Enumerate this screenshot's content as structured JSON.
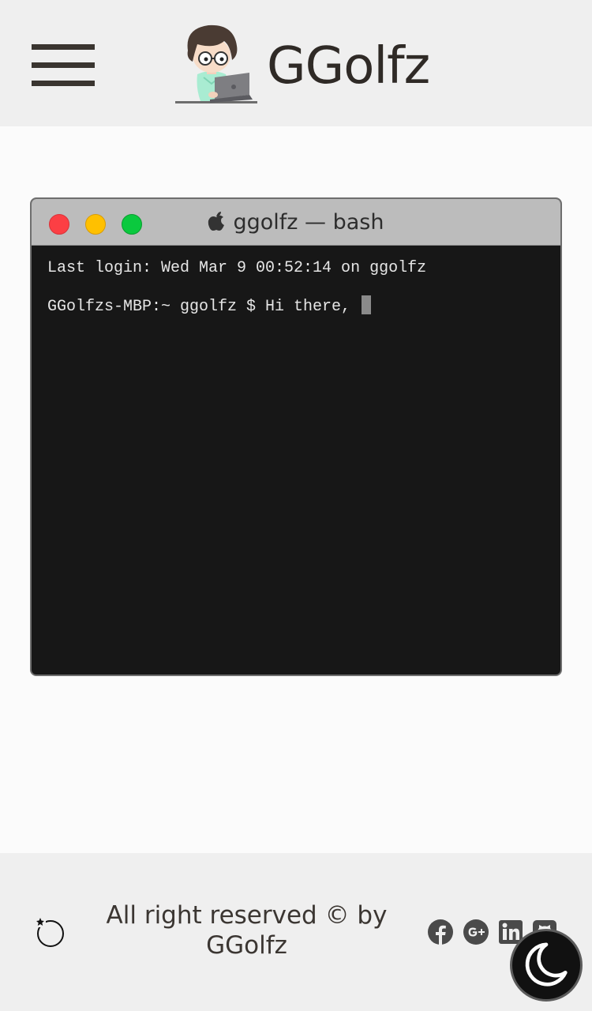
{
  "header": {
    "brand": "GGolfz",
    "menu_icon": "hamburger-menu-icon",
    "avatar_icon": "developer-avatar-illustration"
  },
  "terminal": {
    "title": "ggolfz — bash",
    "title_icon": "apple-logo-icon",
    "window_buttons": [
      "close",
      "minimize",
      "maximize"
    ],
    "colors": {
      "close": "#fc3f44",
      "minimize": "#ffc000",
      "maximize": "#0ac93e",
      "background": "#171717",
      "titlebar": "#bcbcbc"
    },
    "lines": [
      "Last login: Wed Mar 9 00:52:14 on ggolfz",
      "GGolfzs-MBP:~ ggolfz $ Hi there,"
    ]
  },
  "footer": {
    "copyright": "All right reserved © by GGolfz",
    "spinner_icon": "loading-spinner-icon",
    "social": [
      "facebook-icon",
      "google-plus-icon",
      "linkedin-icon",
      "github-icon"
    ]
  },
  "theme_toggle": {
    "icon": "moon-icon",
    "mode": "dark"
  }
}
